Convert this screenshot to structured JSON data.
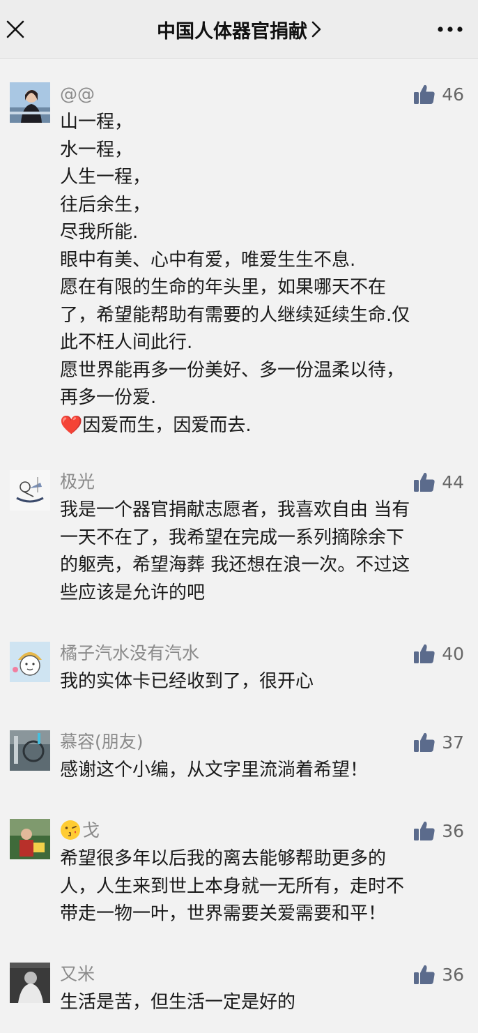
{
  "header": {
    "title": "中国人体器官捐献"
  },
  "comments": [
    {
      "nickname": "@@",
      "likes": "46",
      "lines": [
        "山一程，",
        "水一程，",
        "人生一程，",
        "往后余生，",
        "尽我所能.",
        "眼中有美、心中有爱，唯爱生生不息.",
        "愿在有限的生命的年头里，如果哪天不在",
        "了，希望能帮助有需要的人继续延续生命.仅",
        "此不枉人间此行.",
        "愿世界能再多一份美好、多一份温柔以待，",
        "再多一份爱.",
        "因爱而生，因爱而去."
      ],
      "heart": "❤️"
    },
    {
      "nickname": "极光",
      "likes": "44",
      "lines": [
        "我是一个器官捐献志愿者，我喜欢自由 当有",
        "一天不在了，我希望在完成一系列摘除余下",
        "的躯壳，希望海葬 我还想在浪一次。不过这",
        "些应该是允许的吧"
      ]
    },
    {
      "nickname": "橘子汽水没有汽水",
      "likes": "40",
      "lines": [
        "我的实体卡已经收到了，很开心"
      ]
    },
    {
      "nickname": "慕容(朋友)",
      "likes": "37",
      "lines": [
        "感谢这个小编，从文字里流淌着希望！"
      ]
    },
    {
      "nickname": "戈",
      "nickname_emoji": "😘",
      "likes": "36",
      "lines": [
        "希望很多年以后我的离去能够帮助更多的",
        "人，人生来到世上本身就一无所有，走时不",
        "带走一物一叶，世界需要关爱需要和平！"
      ]
    },
    {
      "nickname": "又米",
      "likes": "36",
      "lines": [
        "生活是苦，但生活一定是好的"
      ]
    }
  ],
  "icons": {
    "close": "close-icon",
    "chevron": "chevron-right-icon",
    "more": "more-dots-icon",
    "like": "thumbs-up-icon"
  },
  "colors": {
    "like_icon": "#5b6b8c",
    "heart": "#e0242d",
    "nickname": "#8a8a8a"
  }
}
